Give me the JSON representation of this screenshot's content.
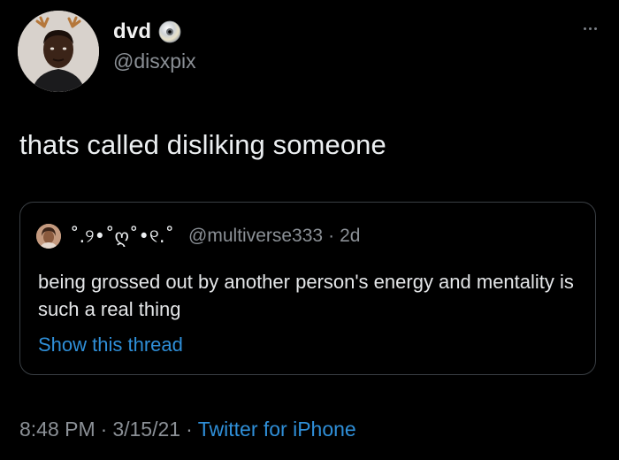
{
  "author": {
    "display_name": "dvd",
    "handle": "@disxpix",
    "avatar_icon": "profile-photo",
    "badge_icon": "cd-disc-icon"
  },
  "tweet": {
    "text": "thats called disliking someone"
  },
  "quoted": {
    "display_name": "˚.୨•˚ღ˚•୧.˚",
    "handle": "@multiverse333",
    "dot": "·",
    "time": "2d",
    "text": "being grossed out by another person's energy and mentality is such a real thing",
    "show_thread_label": "Show this thread"
  },
  "footer": {
    "time": "8:48 PM",
    "date": "3/15/21",
    "client": "Twitter for iPhone",
    "separator": "·"
  },
  "colors": {
    "background": "#000000",
    "text": "#e7e9ea",
    "muted": "#8b9096",
    "link": "#2f8fd8",
    "border": "#3a3f44"
  }
}
